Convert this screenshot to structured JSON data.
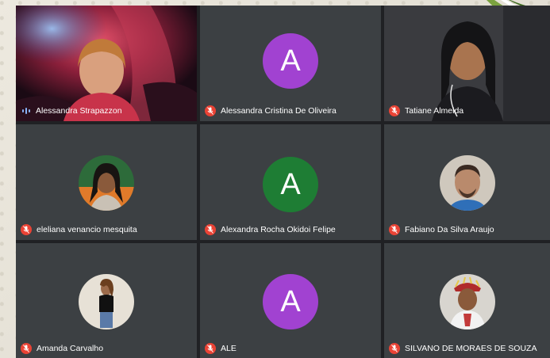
{
  "participants": [
    {
      "name": "Alessandra Strapazzon",
      "mic": "speaking",
      "tile": "camera"
    },
    {
      "name": "Alessandra Cristina De Oliveira",
      "mic": "muted",
      "tile": "letter",
      "letter": "A",
      "color": "#a142d1"
    },
    {
      "name": "Tatiane Almeida",
      "mic": "muted",
      "tile": "camera"
    },
    {
      "name": "eleliana venancio mesquita",
      "mic": "muted",
      "tile": "photo"
    },
    {
      "name": "Alexandra Rocha Okidoi Felipe",
      "mic": "muted",
      "tile": "letter",
      "letter": "A",
      "color": "#1e7d34"
    },
    {
      "name": "Fabiano Da Silva Araujo",
      "mic": "muted",
      "tile": "photo"
    },
    {
      "name": "Amanda Carvalho",
      "mic": "muted",
      "tile": "photo"
    },
    {
      "name": "ALE",
      "mic": "muted",
      "tile": "letter",
      "letter": "A",
      "color": "#a142d1"
    },
    {
      "name": "SILVANO DE MORAES DE SOUZA",
      "mic": "muted",
      "tile": "photo"
    }
  ],
  "colors": {
    "window_bg": "#202124",
    "tile_bg": "#3c4043",
    "mic_off": "#ea4335",
    "speaking": "#8ab4f8"
  }
}
